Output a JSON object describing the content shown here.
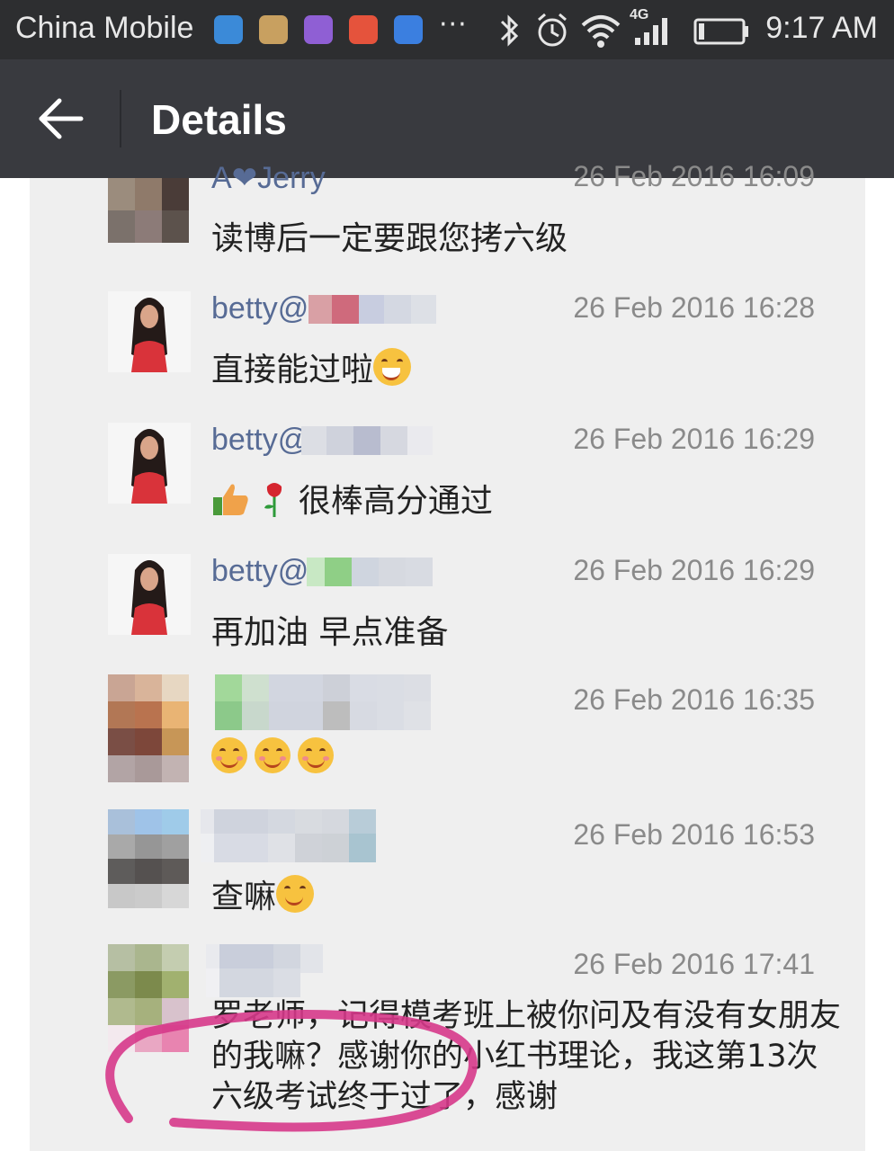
{
  "status_bar": {
    "carrier": "China Mobile",
    "more": "···",
    "network_label": "4G",
    "time": "9:17 AM"
  },
  "header": {
    "title": "Details",
    "back_icon": "back-arrow-icon"
  },
  "comments": [
    {
      "name": "A❤Jerry",
      "time": "26 Feb 2016 16:09",
      "text": "读博后一定要跟您拷六级"
    },
    {
      "name": "betty@",
      "time": "26 Feb 2016 16:28",
      "text": "直接能过啦",
      "emoji": "grin-emoji-icon"
    },
    {
      "name": "betty@",
      "time": "26 Feb 2016 16:29",
      "text": "很棒高分通过",
      "emoji": [
        "thumbs-up-icon",
        "rose-icon"
      ]
    },
    {
      "name": "betty@",
      "time": "26 Feb 2016 16:29",
      "text": "再加油 早点准备"
    },
    {
      "name": "",
      "time": "26 Feb 2016 16:35",
      "text": "",
      "emoji": [
        "blush-emoji-icon",
        "blush-emoji-icon",
        "blush-emoji-icon"
      ]
    },
    {
      "name": "",
      "time": "26 Feb 2016 16:53",
      "text": "查嘛",
      "emoji": "smile-emoji-icon"
    },
    {
      "name": "",
      "time": "26 Feb 2016 17:41",
      "text": "罗老师，记得模考班上被你问及有没有女朋友的我嘛？感谢你的小红书理论，我这第13次六级考试终于过了，感谢"
    }
  ],
  "colors": {
    "status_bar_bg": "#2d2e30",
    "title_bar_bg": "#393a3f",
    "card_bg": "#efefef",
    "name_blue": "#576b95",
    "timestamp_gray": "#8a8a8a",
    "highlight_circle": "#d6388a"
  }
}
